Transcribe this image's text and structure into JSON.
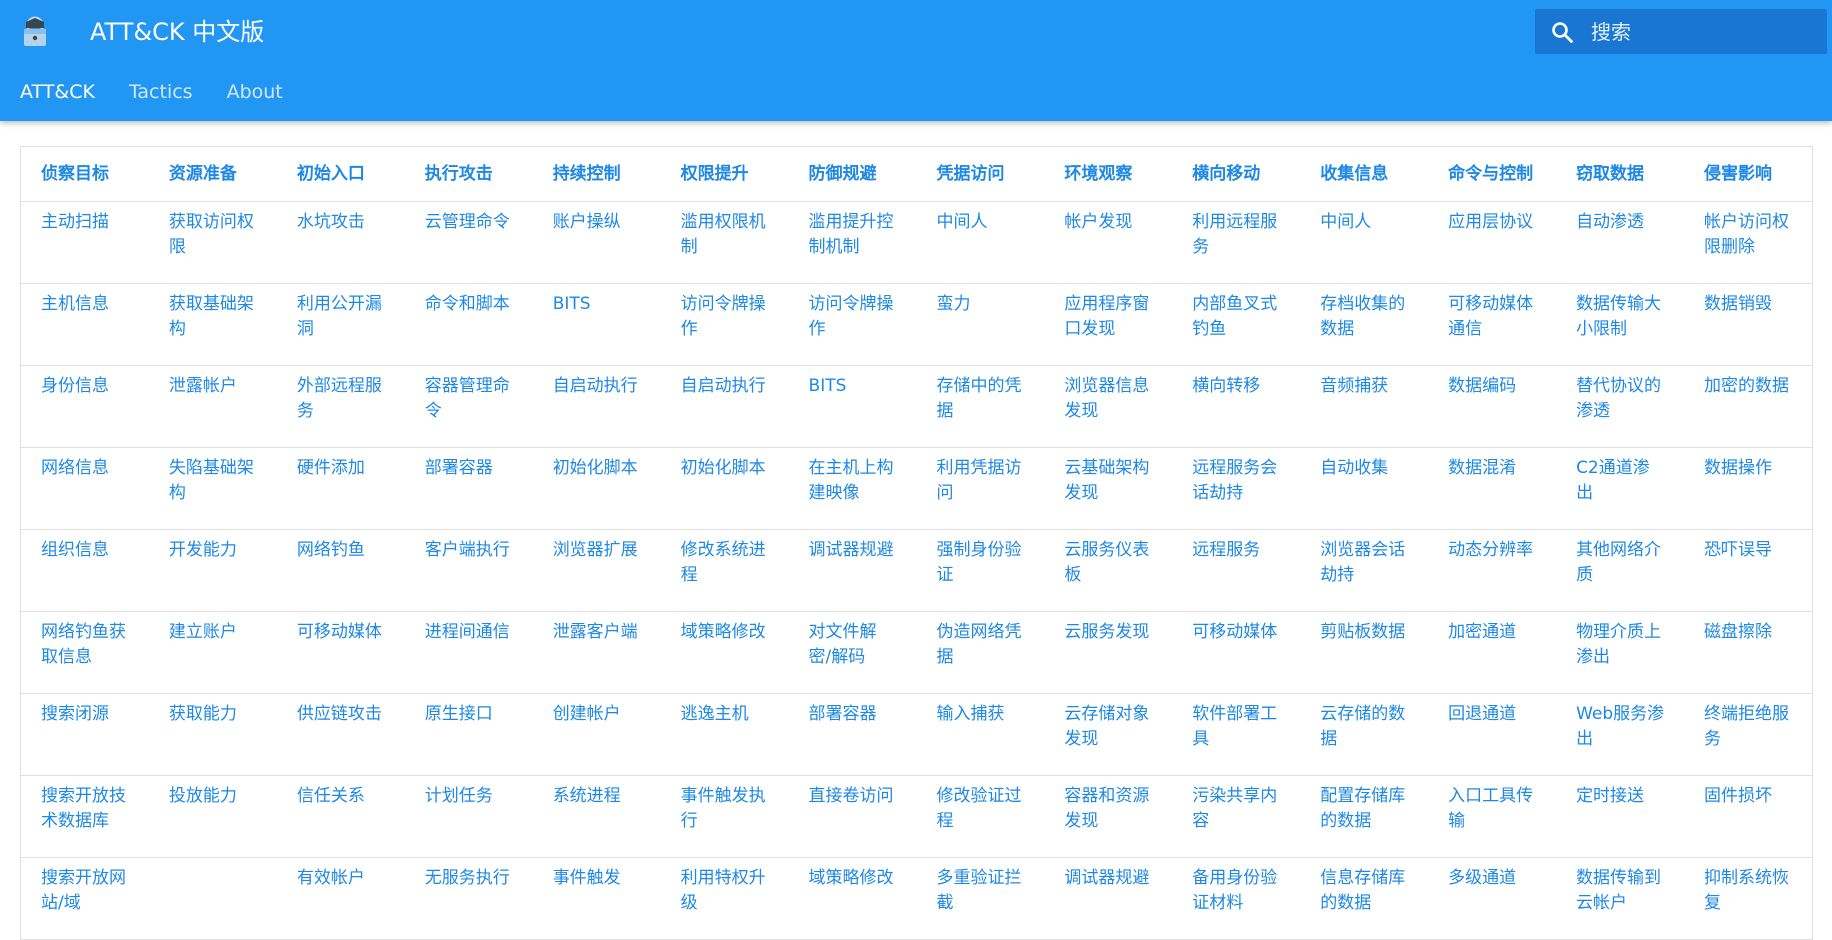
{
  "header": {
    "title": "ATT&CK 中文版",
    "logo_icon": "lock-logo-icon",
    "brand_color": "#2196f3"
  },
  "search": {
    "placeholder": "搜索",
    "icon": "search-icon"
  },
  "nav": {
    "items": [
      "ATT&CK",
      "Tactics",
      "About"
    ],
    "active": "ATT&CK"
  },
  "table": {
    "headers": [
      "侦察目标",
      "资源准备",
      "初始入口",
      "执行攻击",
      "持续控制",
      "权限提升",
      "防御规避",
      "凭据访问",
      "环境观察",
      "横向移动",
      "收集信息",
      "命令与控制",
      "窃取数据",
      "侵害影响"
    ],
    "rows": [
      [
        "主动扫描",
        "获取访问权限",
        "水坑攻击",
        "云管理命令",
        "账户操纵",
        "滥用权限机制",
        "滥用提升控制机制",
        "中间人",
        "帐户发现",
        "利用远程服务",
        "中间人",
        "应用层协议",
        "自动渗透",
        "帐户访问权限删除"
      ],
      [
        "主机信息",
        "获取基础架构",
        "利用公开漏洞",
        "命令和脚本",
        "BITS",
        "访问令牌操作",
        "访问令牌操作",
        "蛮力",
        "应用程序窗口发现",
        "内部鱼叉式钓鱼",
        "存档收集的数据",
        "可移动媒体通信",
        "数据传输大小限制",
        "数据销毁"
      ],
      [
        "身份信息",
        "泄露帐户",
        "外部远程服务",
        "容器管理命令",
        "自启动执行",
        "自启动执行",
        "BITS",
        "存储中的凭据",
        "浏览器信息发现",
        "横向转移",
        "音频捕获",
        "数据编码",
        "替代协议的渗透",
        "加密的数据"
      ],
      [
        "网络信息",
        "失陷基础架构",
        "硬件添加",
        "部署容器",
        "初始化脚本",
        "初始化脚本",
        "在主机上构建映像",
        "利用凭据访问",
        "云基础架构发现",
        "远程服务会话劫持",
        "自动收集",
        "数据混淆",
        "C2通道渗出",
        "数据操作"
      ],
      [
        "组织信息",
        "开发能力",
        "网络钓鱼",
        "客户端执行",
        "浏览器扩展",
        "修改系统进程",
        "调试器规避",
        "强制身份验证",
        "云服务仪表板",
        "远程服务",
        "浏览器会话劫持",
        "动态分辨率",
        "其他网络介质",
        "恐吓误导"
      ],
      [
        "网络钓鱼获取信息",
        "建立账户",
        "可移动媒体",
        "进程间通信",
        "泄露客户端",
        "域策略修改",
        "对文件解密/解码",
        "伪造网络凭据",
        "云服务发现",
        "可移动媒体",
        "剪贴板数据",
        "加密通道",
        "物理介质上渗出",
        "磁盘擦除"
      ],
      [
        "搜索闭源",
        "获取能力",
        "供应链攻击",
        "原生接口",
        "创建帐户",
        "逃逸主机",
        "部署容器",
        "输入捕获",
        "云存储对象发现",
        "软件部署工具",
        "云存储的数据",
        "回退通道",
        "Web服务渗出",
        "终端拒绝服务"
      ],
      [
        "搜索开放技术数据库",
        "投放能力",
        "信任关系",
        "计划任务",
        "系统进程",
        "事件触发执行",
        "直接卷访问",
        "修改验证过程",
        "容器和资源发现",
        "污染共享内容",
        "配置存储库的数据",
        "入口工具传输",
        "定时接送",
        "固件损坏"
      ],
      [
        "搜索开放网站/域",
        "",
        "有效帐户",
        "无服务执行",
        "事件触发",
        "利用特权升级",
        "域策略修改",
        "多重验证拦截",
        "调试器规避",
        "备用身份验证材料",
        "信息存储库的数据",
        "多级通道",
        "数据传输到云帐户",
        "抑制系统恢复"
      ]
    ]
  }
}
